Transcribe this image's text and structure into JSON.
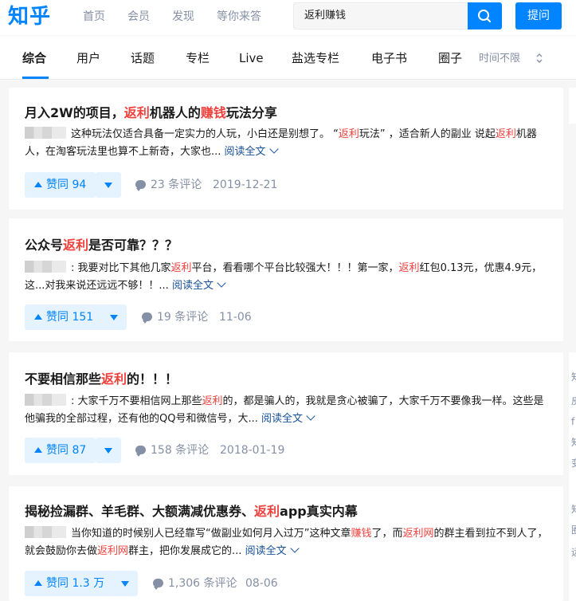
{
  "header": {
    "logo": "知乎",
    "nav": [
      "首页",
      "会员",
      "发现",
      "等你来答"
    ],
    "search_value": "返利赚钱",
    "ask_label": "提问"
  },
  "tabs": [
    "综合",
    "用户",
    "话题",
    "专栏",
    "Live",
    "盐选专栏",
    "电子书",
    "圈子"
  ],
  "time_filter": "时间不限",
  "colors": {
    "brand": "#0084ff",
    "highlight": "#f1403c",
    "link": "#175199"
  },
  "results": [
    {
      "title_parts": [
        "月入2W的项目，",
        "返利",
        "机器人的",
        "赚钱",
        "玩法分享"
      ],
      "excerpt_parts": [
        "这种玩法仅适合具备一定实力的人玩，小白还是别想了。 “",
        "返利",
        "玩法” ，适合新人的副业 说起",
        "返利",
        "机器人，在淘客玩法里也算不上新奇，大家也..."
      ],
      "read_more": "阅读全文",
      "vote": "赞同 94",
      "comments": "23 条评论",
      "date": "2019-12-21"
    },
    {
      "title_parts": [
        "公众号",
        "返利",
        "是否可靠？？？"
      ],
      "excerpt_parts": ": 我要对比下其他几家",
      "excerpt_parts_full": [
        ": 我要对比下其他几家",
        "返利",
        "平台，看看哪个平台比较强大！！！第一家，",
        "返利",
        "红包0.13元，优惠4.9元，这...对我来说还远远不够！！..."
      ],
      "read_more": "阅读全文",
      "vote": "赞同 151",
      "comments": "19 条评论",
      "date": "11-06"
    },
    {
      "title_parts": [
        "不要相信那些",
        "返利",
        "的！！！"
      ],
      "excerpt_parts_full": [
        ": 大家千万不要相信网上那些",
        "返利",
        "的，都是骗人的，我就是贪心被骗了，大家千万不要像我一样。这些是他骗我的全部过程，还有他的QQ号和微信号，大..."
      ],
      "read_more": "阅读全文",
      "vote": "赞同 87",
      "comments": "158 条评论",
      "date": "2018-01-19"
    },
    {
      "title_parts": [
        "揭秘捡漏群、羊毛群、大额满减优惠券、",
        "返利",
        "app真实内幕"
      ],
      "excerpt_parts_full": [
        "当你知道的时候别人已经靠写“做副业如何月入过万”这种文章",
        "赚钱",
        "了，而",
        "返利网",
        "的群主看到拉不到人了，就会鼓励你去做",
        "返利网",
        "群主，把你发展成它的..."
      ],
      "read_more": "阅读全文",
      "vote": "赞同 1.3 万",
      "comments": "1,306 条评论",
      "date": "08-06"
    }
  ],
  "sidebar_chars": [
    "知",
    "皮",
    "f",
    "知",
    "变",
    "知",
    "圈",
    "远"
  ]
}
